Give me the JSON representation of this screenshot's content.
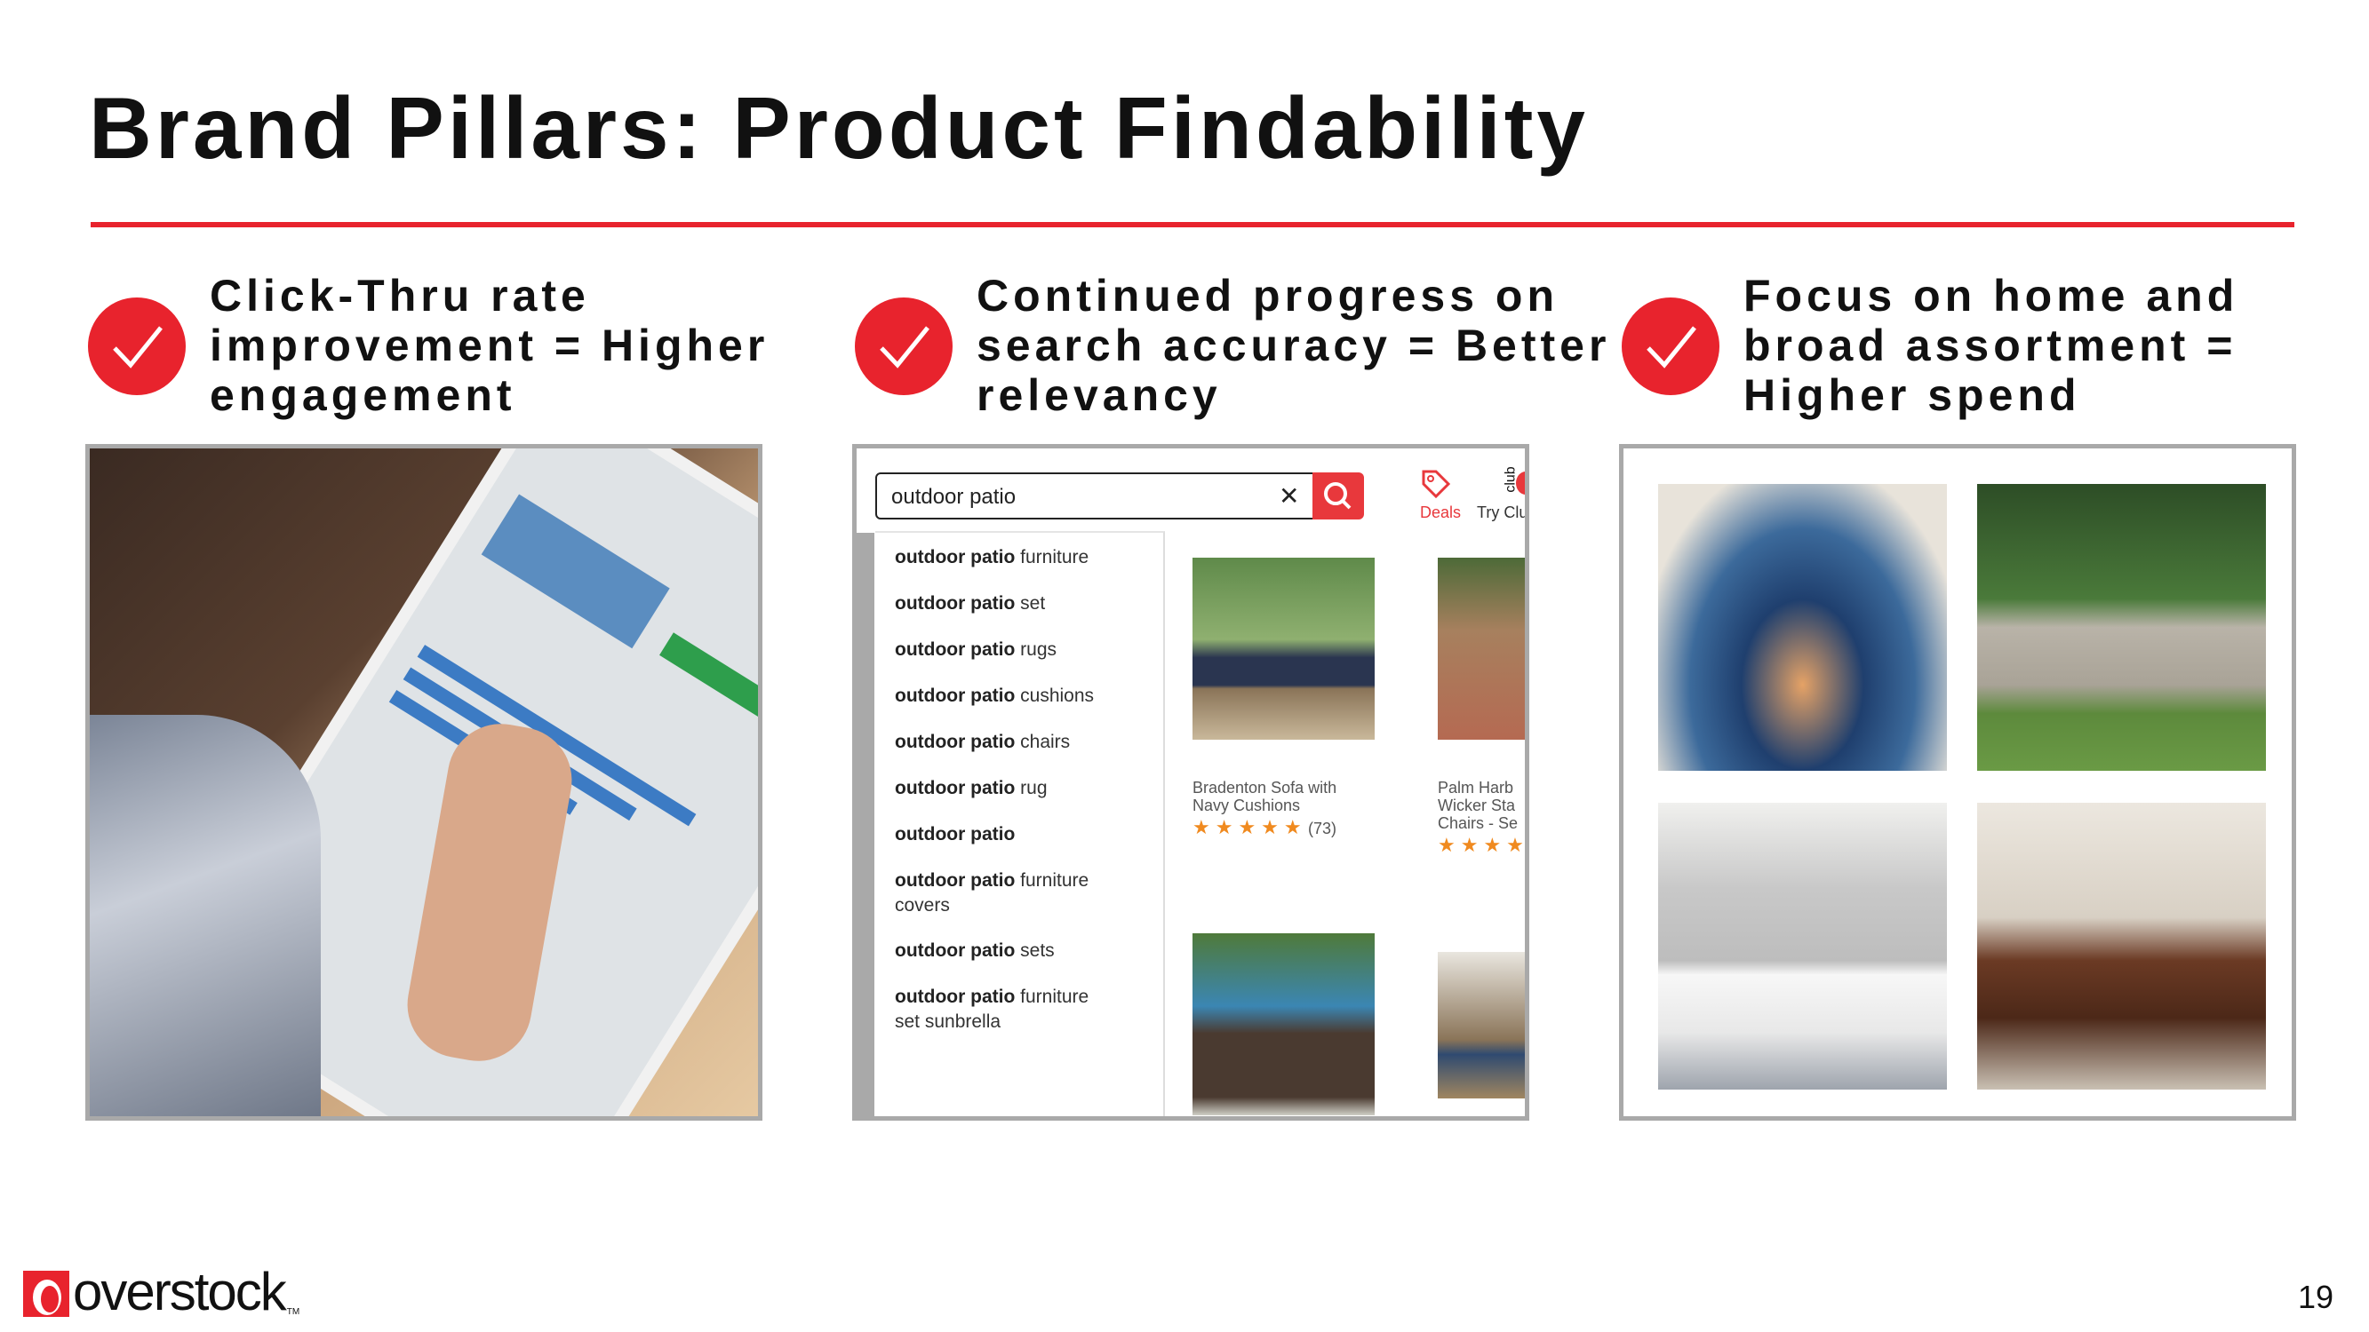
{
  "title": "Brand Pillars: Product Findability",
  "pillars": [
    {
      "icon": "check-icon",
      "line1": "Click-Thru rate",
      "line2": "improvement = Higher",
      "line3": "engagement"
    },
    {
      "icon": "check-icon",
      "line1": "Continued progress on",
      "line2": "search accuracy = Better",
      "line3": "relevancy"
    },
    {
      "icon": "check-icon",
      "line1": "Focus on home and",
      "line2": "broad assortment =",
      "line3": "Higher spend"
    }
  ],
  "search": {
    "query": "outdoor patio",
    "clear_icon": "close-icon",
    "search_icon": "search-icon",
    "deals_label": "Deals",
    "club_badge": "club",
    "club_label": "Try Clu",
    "suggestions": [
      {
        "bold": "outdoor patio",
        "rest": " furniture"
      },
      {
        "bold": "outdoor patio",
        "rest": " set"
      },
      {
        "bold": "outdoor patio",
        "rest": " rugs"
      },
      {
        "bold": "outdoor patio",
        "rest": " cushions"
      },
      {
        "bold": "outdoor patio",
        "rest": " chairs"
      },
      {
        "bold": "outdoor patio",
        "rest": " rug"
      },
      {
        "bold": "outdoor patio",
        "rest": ""
      },
      {
        "bold": "outdoor patio",
        "rest": " furniture covers"
      },
      {
        "bold": "outdoor patio",
        "rest": " sets"
      },
      {
        "bold": "outdoor patio",
        "rest": " furniture set sunbrella"
      }
    ],
    "products": [
      {
        "name_l1": "Bradenton Sofa with",
        "name_l2": "Navy Cushions",
        "rating": 4.5,
        "reviews": "(73)",
        "stars": "★★★★★"
      },
      {
        "name_l1": "Palm Harb",
        "name_l2": "Wicker Sta",
        "name_l3": "Chairs - Se",
        "stars": "★★★★"
      }
    ]
  },
  "colors": {
    "accent": "#e8232d",
    "star": "#f08a1f"
  },
  "footer": {
    "logo_text": "overstock",
    "tm": "TM",
    "page_number": "19"
  }
}
